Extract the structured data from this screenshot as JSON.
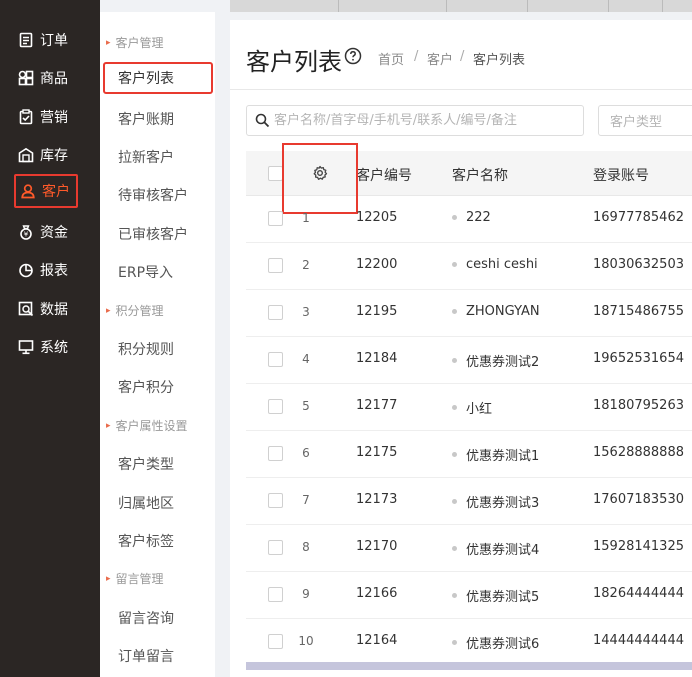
{
  "sidebar": {
    "items": [
      {
        "label": "订单",
        "icon": "order-icon"
      },
      {
        "label": "商品",
        "icon": "goods-icon"
      },
      {
        "label": "营销",
        "icon": "marketing-icon"
      },
      {
        "label": "库存",
        "icon": "warehouse-icon"
      },
      {
        "label": "客户",
        "icon": "user-icon",
        "active": true
      },
      {
        "label": "资金",
        "icon": "money-bag-icon"
      },
      {
        "label": "报表",
        "icon": "pie-chart-icon"
      },
      {
        "label": "数据",
        "icon": "data-search-icon"
      },
      {
        "label": "系统",
        "icon": "monitor-icon"
      }
    ],
    "accent": "#ff5a2a"
  },
  "subnav": {
    "groups": [
      {
        "title": "客户管理",
        "items": [
          "客户列表",
          "客户账期",
          "拉新客户",
          "待审核客户",
          "已审核客户",
          "ERP导入"
        ]
      },
      {
        "title": "积分管理",
        "items": [
          "积分规则",
          "客户积分"
        ]
      },
      {
        "title": "客户属性设置",
        "items": [
          "客户类型",
          "归属地区",
          "客户标签"
        ]
      },
      {
        "title": "留言管理",
        "items": [
          "留言咨询",
          "订单留言"
        ]
      }
    ]
  },
  "header": {
    "title": "客户列表",
    "breadcrumb": [
      "首页",
      "客户",
      "客户列表"
    ],
    "breadcrumb_sep": "/"
  },
  "filters": {
    "search_placeholder": "客户名称/首字母/手机号/联系人/编号/备注",
    "type_placeholder": "客户类型"
  },
  "table": {
    "columns": [
      "客户编号",
      "客户名称",
      "登录账号"
    ],
    "rows": [
      {
        "idx": "1",
        "code": "12205",
        "name": "222",
        "account": "16977785462"
      },
      {
        "idx": "2",
        "code": "12200",
        "name": "ceshi ceshi",
        "account": "18030632503"
      },
      {
        "idx": "3",
        "code": "12195",
        "name": "ZHONGYAN",
        "account": "18715486755"
      },
      {
        "idx": "4",
        "code": "12184",
        "name": "优惠券测试2",
        "account": "19652531654"
      },
      {
        "idx": "5",
        "code": "12177",
        "name": "小红",
        "account": "18180795263"
      },
      {
        "idx": "6",
        "code": "12175",
        "name": "优惠券测试1",
        "account": "15628888888"
      },
      {
        "idx": "7",
        "code": "12173",
        "name": "优惠券测试3",
        "account": "17607183530"
      },
      {
        "idx": "8",
        "code": "12170",
        "name": "优惠券测试4",
        "account": "15928141325"
      },
      {
        "idx": "9",
        "code": "12166",
        "name": "优惠券测试5",
        "account": "18264444444"
      },
      {
        "idx": "10",
        "code": "12164",
        "name": "优惠券测试6",
        "account": "14444444444"
      }
    ]
  },
  "highlight_color": "#e83a2f"
}
